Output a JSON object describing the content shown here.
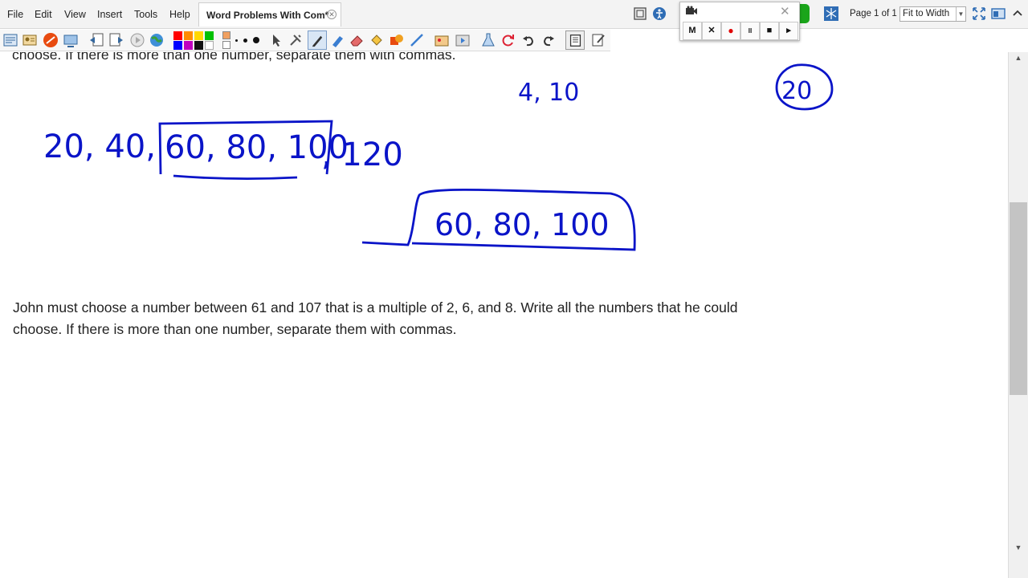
{
  "menu": {
    "items": [
      "File",
      "Edit",
      "View",
      "Insert",
      "Tools",
      "Help"
    ]
  },
  "document_tab": {
    "title": "Word Problems With Com*"
  },
  "view": {
    "page_indicator": "Page 1 of 1",
    "zoom": "Fit to Width"
  },
  "toolbar": {
    "palette_colors": [
      "#ff0000",
      "#ff8c00",
      "#ffd800",
      "#00c000",
      "#0000ff",
      "#c000c0",
      "#111111",
      "#ffffff"
    ],
    "pen_color": "#0a14c8"
  },
  "recorder": {
    "buttons": [
      "M",
      "✕",
      "●",
      "II",
      "■",
      "▸"
    ]
  },
  "page": {
    "cut_off_text": "choose. If there is more than one number, separate them with commas.",
    "problem_line1": "John must choose a number between 61 and 107 that is a multiple of 2, 6, and 8. Write all the numbers that he could",
    "problem_line2": "choose. If there is more than one number, separate them with commas."
  },
  "handwriting": {
    "factors": "4, 10",
    "circled_answer": "20",
    "multiples_before": "20,  40,",
    "multiples_boxed": "60, 80, 100",
    "multiples_after": ", 120",
    "final_answer": "60, 80, 100"
  }
}
